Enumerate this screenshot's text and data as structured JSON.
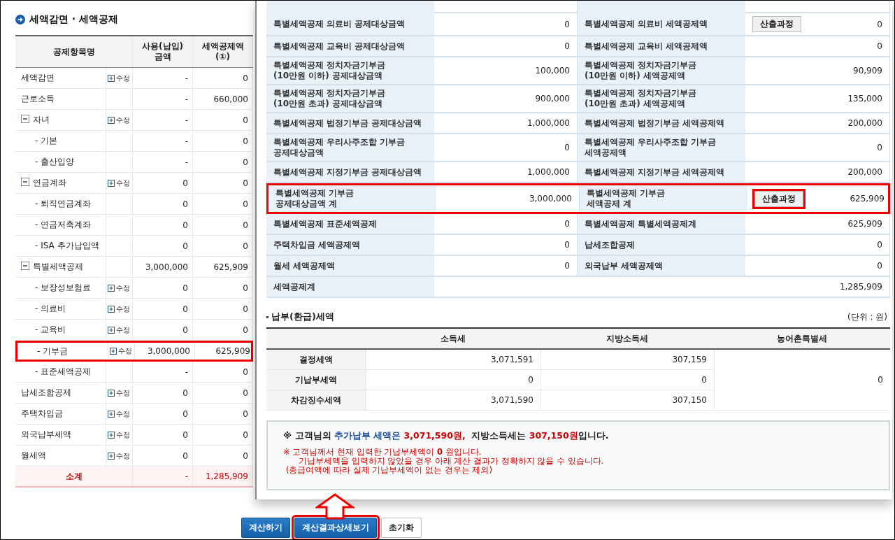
{
  "left_panel": {
    "title": "세액감면 · 세액공제",
    "columns": [
      "공제항목명",
      "사용(납입)\n금액",
      "세액공제액\n(①)"
    ],
    "rows": [
      {
        "kind": "item",
        "name": "세액감면",
        "edit": "수정",
        "amount": "-",
        "credit": "0",
        "highlighted": false
      },
      {
        "kind": "item",
        "name": "근로소득",
        "amount": "-",
        "credit": "660,000",
        "highlighted": false
      },
      {
        "kind": "group",
        "name": "자녀",
        "edit": "수정",
        "amount": "-",
        "credit": "0",
        "expanded": true,
        "highlighted": false,
        "children": [
          {
            "kind": "child",
            "name": "- 기본",
            "amount": "-",
            "credit": "0",
            "highlighted": false
          },
          {
            "kind": "child",
            "name": "- 출산입양",
            "amount": "-",
            "credit": "0",
            "highlighted": false
          }
        ]
      },
      {
        "kind": "group",
        "name": "연금계좌",
        "edit": "수정",
        "amount": "0",
        "credit": "0",
        "expanded": true,
        "highlighted": false,
        "children": [
          {
            "kind": "child",
            "name": "- 퇴직연금계좌",
            "amount": "0",
            "credit": "0",
            "highlighted": false
          },
          {
            "kind": "child",
            "name": "- 연금저축계좌",
            "amount": "0",
            "credit": "0",
            "highlighted": false
          },
          {
            "kind": "child",
            "name": "- ISA 추가납입액",
            "amount": "0",
            "credit": "0",
            "highlighted": false
          }
        ]
      },
      {
        "kind": "group",
        "name": "특별세액공제",
        "amount": "3,000,000",
        "credit": "625,909",
        "expanded": true,
        "highlighted": false,
        "children": [
          {
            "kind": "child",
            "name": "- 보장성보험료",
            "edit": "수정",
            "amount": "0",
            "credit": "0",
            "highlighted": false
          },
          {
            "kind": "child",
            "name": "- 의료비",
            "edit": "수정",
            "amount": "0",
            "credit": "0",
            "highlighted": false
          },
          {
            "kind": "child",
            "name": "- 교육비",
            "edit": "수정",
            "amount": "0",
            "credit": "0",
            "highlighted": false
          },
          {
            "kind": "child",
            "name": "- 기부금",
            "edit": "수정",
            "amount": "3,000,000",
            "credit": "625,909",
            "highlighted": true
          },
          {
            "kind": "child",
            "name": "- 표준세액공제",
            "amount": "-",
            "credit": "0",
            "highlighted": false
          }
        ]
      },
      {
        "kind": "item",
        "name": "납세조합공제",
        "edit": "수정",
        "amount": "0",
        "credit": "0",
        "highlighted": false
      },
      {
        "kind": "item",
        "name": "주택차입금",
        "edit": "수정",
        "amount": "0",
        "credit": "0",
        "highlighted": false
      },
      {
        "kind": "item",
        "name": "외국납부세액",
        "edit": "수정",
        "amount": "0",
        "credit": "0",
        "highlighted": false
      },
      {
        "kind": "item",
        "name": "월세액",
        "edit": "수정",
        "amount": "0",
        "credit": "0",
        "highlighted": false
      }
    ],
    "subtotal": {
      "label": "소계",
      "amount": "-",
      "credit": "1,285,909"
    }
  },
  "detail_popup": {
    "credit_rows": [
      {
        "label_1": "특별세액공제 의료비 공제대상금액",
        "value_1": "0",
        "label_2": "특별세액공제 의료비 세액공제액",
        "button": "산출과정",
        "button_highlighted": false,
        "value_2": "0",
        "highlighted": false
      },
      {
        "label_1": "특별세액공제 교육비 공제대상금액",
        "value_1": "0",
        "label_2": "특별세액공제 교육비 세액공제액",
        "value_2": "0",
        "highlighted": false
      },
      {
        "label_1": "특별세액공제 정치자금기부금\n(10만원 이하) 공제대상금액",
        "value_1": "100,000",
        "label_2": "특별세액공제 정치자금기부금\n(10만원 이하) 세액공제액",
        "value_2": "90,909",
        "highlighted": false
      },
      {
        "label_1": "특별세액공제 정치자금기부금\n(10만원 초과) 공제대상금액",
        "value_1": "900,000",
        "label_2": "특별세액공제 정치자금기부금\n(10만원 초과) 세액공제액",
        "value_2": "135,000",
        "highlighted": false
      },
      {
        "label_1": "특별세액공제 법정기부금 공제대상금액",
        "value_1": "1,000,000",
        "label_2": "특별세액공제 법정기부금 세액공제액",
        "value_2": "200,000",
        "highlighted": false
      },
      {
        "label_1": "특별세액공제 우리사주조합 기부금\n공제대상금액",
        "value_1": "0",
        "label_2": "특별세액공제 우리사주조합 기부금\n세액공제액",
        "value_2": "0",
        "highlighted": false
      },
      {
        "label_1": "특별세액공제 지정기부금 공제대상금액",
        "value_1": "1,000,000",
        "label_2": "특별세액공제 지정기부금 세액공제액",
        "value_2": "200,000",
        "highlighted": false
      },
      {
        "label_1": "특별세액공제 기부금\n공제대상금액 계",
        "value_1": "3,000,000",
        "label_2": "특별세액공제 기부금\n세액공제 계",
        "button": "산출과정",
        "button_highlighted": true,
        "value_2": "625,909",
        "highlighted": true
      },
      {
        "label_1": "특별세액공제 표준세액공제",
        "value_1": "0",
        "label_2": "특별세액공제 특별세액공제계",
        "value_2": "625,909",
        "highlighted": false
      },
      {
        "label_1": "주택차입금 세액공제액",
        "value_1": "0",
        "label_2": "납세조합공제",
        "value_2": "0",
        "highlighted": false
      },
      {
        "label_1": "월세 세액공제액",
        "value_1": "0",
        "label_2": "외국납부 세액공제액",
        "value_2": "0",
        "highlighted": false
      }
    ],
    "credit_total": {
      "label": "세액공제계",
      "value": "1,285,909"
    },
    "tax_section": {
      "title": "납부(환급)세액",
      "unit": "(단위 : 원)",
      "columns": [
        "소득세",
        "지방소득세",
        "농어촌특별세"
      ],
      "rows": [
        {
          "label": "결정세액",
          "values": [
            "3,071,591",
            "307,159"
          ]
        },
        {
          "label": "기납부세액",
          "values": [
            "0",
            "0"
          ]
        },
        {
          "label": "차감징수세액",
          "values": [
            "3,071,590",
            "307,150"
          ]
        }
      ],
      "special_tax_value": "0"
    },
    "notice": {
      "summary": [
        {
          "kind": "plain",
          "text": "※ 고객님의 "
        },
        {
          "kind": "emphasis",
          "text": "추가납부 세액은 "
        },
        {
          "kind": "amount",
          "text": "3,071,590원,"
        },
        {
          "kind": "plain",
          "text": "  지방소득세는 "
        },
        {
          "kind": "amount",
          "text": "307,150원"
        },
        {
          "kind": "plain",
          "text": "입니다."
        }
      ],
      "warnings": [
        "※ 고객님께서 현재 입력한 기납부세액이 **0** 원입니다.",
        "기납부세액을 입력하지 않았을 경우 아래 계산 결과가 정확하지 않을 수 있습니다.",
        "(총급여액에 따라 실제 기납부세액이 없는 경우는 제외)"
      ]
    }
  },
  "buttons": [
    {
      "label": "계산하기",
      "kind": "primary",
      "highlighted": false
    },
    {
      "label": "계산결과상세보기",
      "kind": "primary",
      "highlighted": true
    },
    {
      "label": "초기화",
      "kind": "plain",
      "highlighted": false
    }
  ]
}
